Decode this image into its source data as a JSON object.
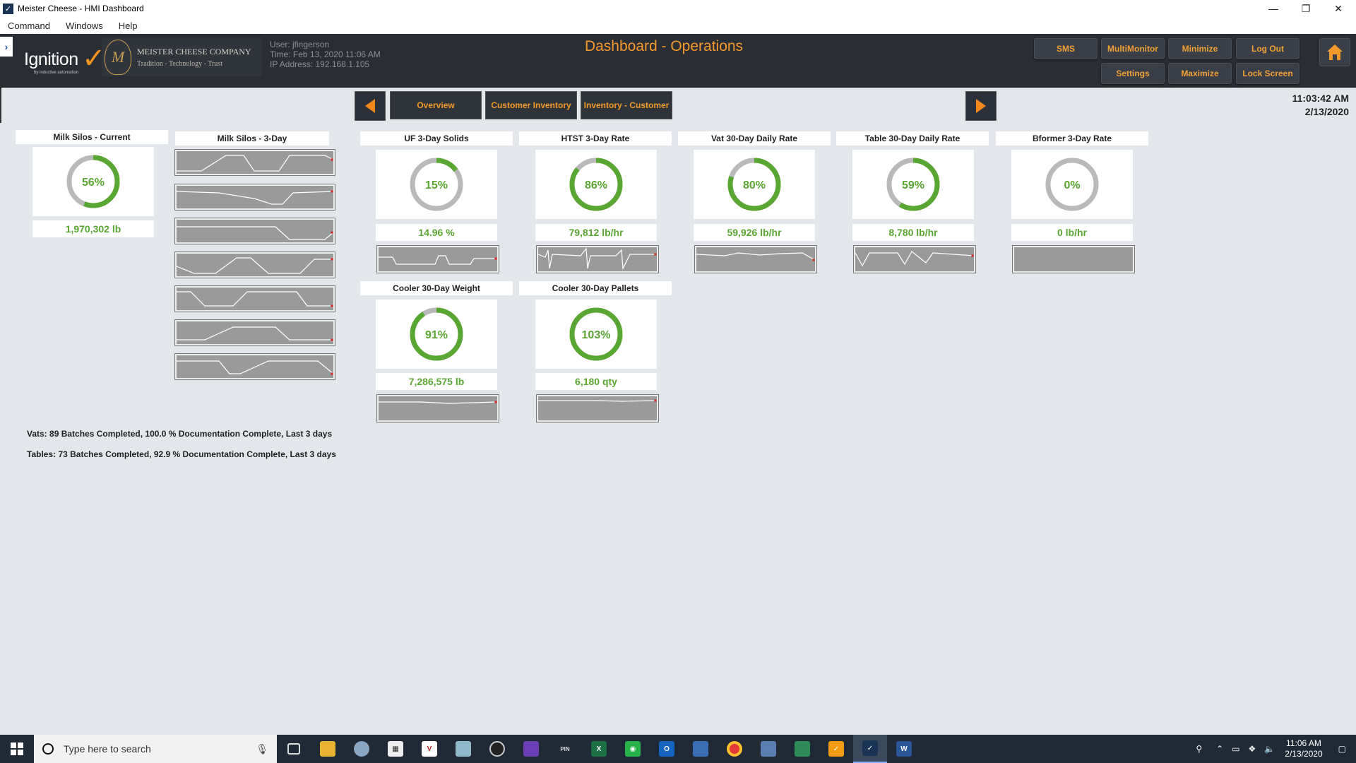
{
  "window": {
    "title": "Meister Cheese - HMI Dashboard",
    "menu": [
      "Command",
      "Windows",
      "Help"
    ]
  },
  "header": {
    "ignition_word": "Ignition",
    "ignition_tagline": "by inductive automation",
    "company_name": "MEISTER CHEESE COMPANY",
    "company_tagline": "Tradition - Technology - Trust",
    "session": {
      "user": "User: jfingerson",
      "time": "Time: Feb 13, 2020 11:06 AM",
      "ip": "IP Address: 192.168.1.105"
    },
    "page_title": "Dashboard - Operations",
    "buttons": {
      "sms": "SMS",
      "multimonitor": "MultiMonitor",
      "minimize": "Minimize",
      "logout": "Log Out",
      "settings": "Settings",
      "maximize": "Maximize",
      "lock": "Lock Screen"
    },
    "accent": "#f49a2c"
  },
  "nav": {
    "overview": "Overview",
    "customer_inventory": "Customer Inventory",
    "inventory_customer": "Inventory - Customer"
  },
  "clock": {
    "time": "11:03:42 AM",
    "date": "2/13/2020"
  },
  "widgets": {
    "milk_current": {
      "title": "Milk Silos - Current",
      "pct": 56,
      "label": "56%",
      "value": "1,970,302 lb"
    },
    "milk_3day": {
      "title": "Milk Silos - 3-Day"
    },
    "uf": {
      "title": "UF 3-Day Solids",
      "pct": 15,
      "label": "15%",
      "value": "14.96 %"
    },
    "htst": {
      "title": "HTST 3-Day Rate",
      "pct": 86,
      "label": "86%",
      "value": "79,812 lb/hr"
    },
    "vat": {
      "title": "Vat 30-Day Daily Rate",
      "pct": 80,
      "label": "80%",
      "value": "59,926 lb/hr"
    },
    "table": {
      "title": "Table 30-Day Daily Rate",
      "pct": 59,
      "label": "59%",
      "value": "8,780 lb/hr"
    },
    "bformer": {
      "title": "Bformer 3-Day Rate",
      "pct": 0,
      "label": "0%",
      "value": "0 lb/hr"
    },
    "cooler_weight": {
      "title": "Cooler 30-Day Weight",
      "pct": 91,
      "label": "91%",
      "value": "7,286,575 lb"
    },
    "cooler_pallets": {
      "title": "Cooler 30-Day Pallets",
      "pct": 103,
      "label": "103%",
      "value": "6,180 qty"
    }
  },
  "colors": {
    "gauge_fill": "#5aa632",
    "gauge_track": "#b9b9b9",
    "spark_bg": "#9a9a9a"
  },
  "summary": {
    "vats": "Vats: 89 Batches Completed, 100.0 % Documentation Complete, Last 3 days",
    "tables": "Tables: 73 Batches Completed, 92.9 % Documentation Complete, Last 3 days"
  },
  "taskbar": {
    "search_placeholder": "Type here to search",
    "time": "11:06 AM",
    "date": "2/13/2020"
  }
}
